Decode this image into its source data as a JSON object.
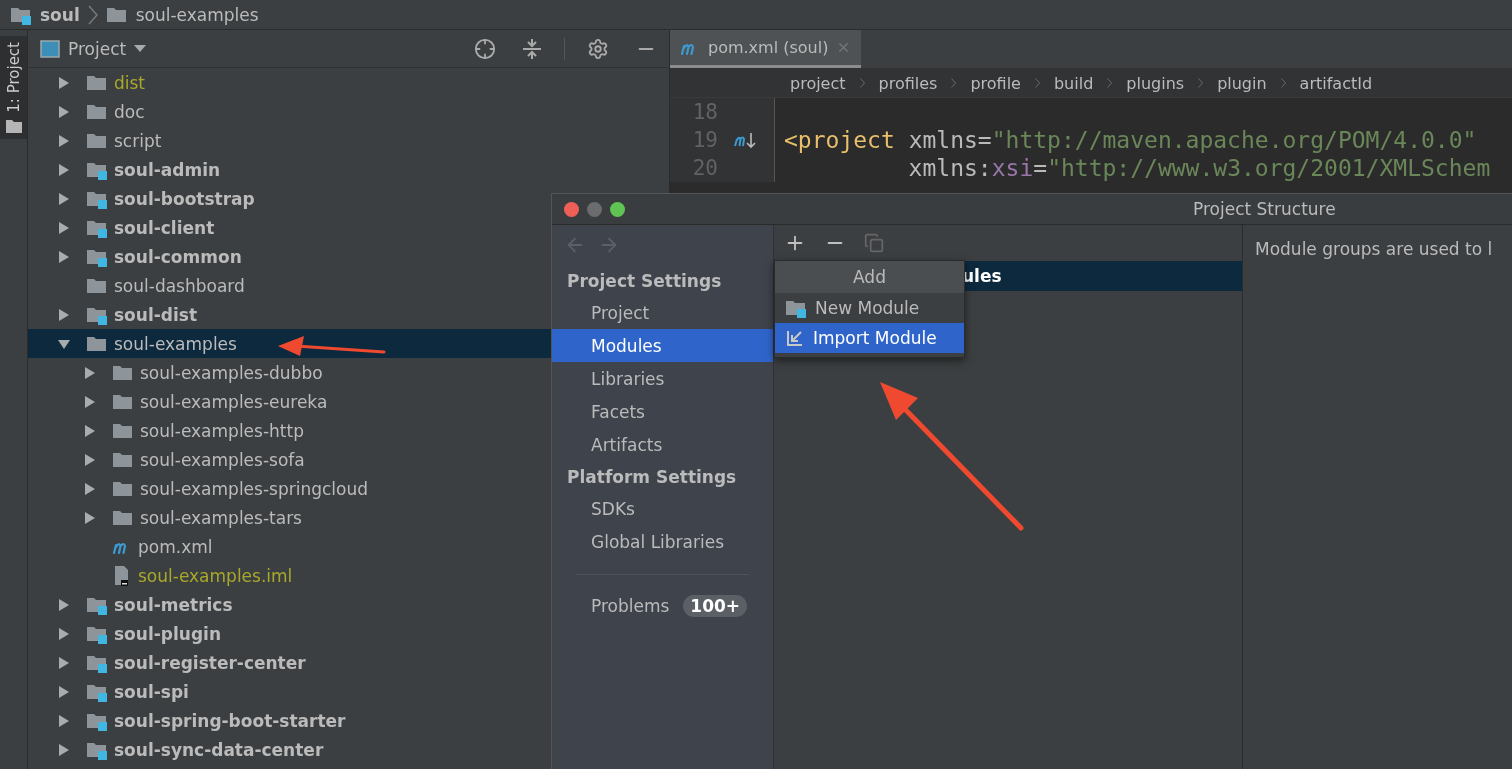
{
  "breadcrumb": [
    {
      "label": "soul",
      "kind": "module"
    },
    {
      "label": "soul-examples",
      "kind": "folder"
    }
  ],
  "tool_strip": {
    "label": "1: Project"
  },
  "project_panel": {
    "title": "Project",
    "tree": [
      {
        "label": "dist",
        "kind": "folder",
        "expanded": false,
        "selected": false,
        "excluded": true
      },
      {
        "label": "doc",
        "kind": "folder",
        "expanded": false,
        "selected": false,
        "excluded": false
      },
      {
        "label": "script",
        "kind": "folder",
        "expanded": false,
        "selected": false,
        "excluded": false
      },
      {
        "label": "soul-admin",
        "kind": "module",
        "expanded": false,
        "selected": false,
        "excluded": false
      },
      {
        "label": "soul-bootstrap",
        "kind": "module",
        "expanded": false,
        "selected": false,
        "excluded": false
      },
      {
        "label": "soul-client",
        "kind": "module",
        "expanded": false,
        "selected": false,
        "excluded": false
      },
      {
        "label": "soul-common",
        "kind": "module",
        "expanded": false,
        "selected": false,
        "excluded": false
      },
      {
        "label": "soul-dashboard",
        "kind": "folder",
        "selected": false,
        "excluded": false
      },
      {
        "label": "soul-dist",
        "kind": "module",
        "expanded": false,
        "selected": false,
        "excluded": false
      },
      {
        "label": "soul-examples",
        "kind": "folder",
        "expanded": true,
        "selected": true,
        "excluded": false,
        "children": [
          {
            "label": "soul-examples-dubbo",
            "kind": "folder",
            "expanded": false,
            "selected": false,
            "excluded": false
          },
          {
            "label": "soul-examples-eureka",
            "kind": "folder",
            "expanded": false,
            "selected": false,
            "excluded": false
          },
          {
            "label": "soul-examples-http",
            "kind": "folder",
            "expanded": false,
            "selected": false,
            "excluded": false
          },
          {
            "label": "soul-examples-sofa",
            "kind": "folder",
            "expanded": false,
            "selected": false,
            "excluded": false
          },
          {
            "label": "soul-examples-springcloud",
            "kind": "folder",
            "expanded": false,
            "selected": false,
            "excluded": false
          },
          {
            "label": "soul-examples-tars",
            "kind": "folder",
            "expanded": false,
            "selected": false,
            "excluded": false
          },
          {
            "label": "pom.xml",
            "kind": "maven",
            "selected": false,
            "excluded": false
          },
          {
            "label": "soul-examples.iml",
            "kind": "iml",
            "selected": false,
            "excluded": true
          }
        ]
      },
      {
        "label": "soul-metrics",
        "kind": "module",
        "expanded": false,
        "selected": false,
        "excluded": false
      },
      {
        "label": "soul-plugin",
        "kind": "module",
        "expanded": false,
        "selected": false,
        "excluded": false
      },
      {
        "label": "soul-register-center",
        "kind": "module",
        "expanded": false,
        "selected": false,
        "excluded": false
      },
      {
        "label": "soul-spi",
        "kind": "module",
        "expanded": false,
        "selected": false,
        "excluded": false
      },
      {
        "label": "soul-spring-boot-starter",
        "kind": "module",
        "expanded": false,
        "selected": false,
        "excluded": false
      },
      {
        "label": "soul-sync-data-center",
        "kind": "module",
        "expanded": false,
        "selected": false,
        "excluded": false
      }
    ]
  },
  "editor": {
    "tab": {
      "label": "pom.xml (soul)",
      "selected": true
    },
    "breadcrumbs": [
      "project",
      "profiles",
      "profile",
      "build",
      "plugins",
      "plugin",
      "artifactId"
    ],
    "lines": [
      {
        "number": "18"
      },
      {
        "number": "19",
        "maven_marker": true,
        "tokens": [
          {
            "text": "<project",
            "color": "#e8bf6a"
          },
          {
            "text": " xmlns=",
            "color": "#bababa"
          },
          {
            "text": "\"http://maven.apache.org/POM/4.0.0\"",
            "color": "#6a8759"
          }
        ]
      },
      {
        "number": "20",
        "tokens": [
          {
            "text": "         xmlns:",
            "color": "#bababa"
          },
          {
            "text": "xsi",
            "color": "#9876aa"
          },
          {
            "text": "=",
            "color": "#bababa"
          },
          {
            "text": "\"http://www.w3.org/2001/XMLSchem",
            "color": "#6a8759"
          }
        ]
      }
    ]
  },
  "dialog": {
    "title": "Project Structure",
    "sections": [
      {
        "heading": "Project Settings",
        "items": [
          {
            "label": "Project",
            "selected": false
          },
          {
            "label": "Modules",
            "selected": true
          },
          {
            "label": "Libraries",
            "selected": false
          },
          {
            "label": "Facets",
            "selected": false
          },
          {
            "label": "Artifacts",
            "selected": false
          }
        ]
      },
      {
        "heading": "Platform Settings",
        "items": [
          {
            "label": "SDKs",
            "selected": false
          },
          {
            "label": "Global Libraries",
            "selected": false
          }
        ]
      }
    ],
    "problems": {
      "label": "Problems",
      "badge": "100+"
    },
    "module_rows": [
      {
        "label": "ules",
        "selected": true
      }
    ],
    "add_menu": {
      "title": "Add",
      "items": [
        {
          "label": "New Module",
          "kind": "new",
          "selected": false
        },
        {
          "label": "Import Module",
          "kind": "import",
          "selected": true
        }
      ]
    },
    "description": "Module groups are used to l"
  }
}
